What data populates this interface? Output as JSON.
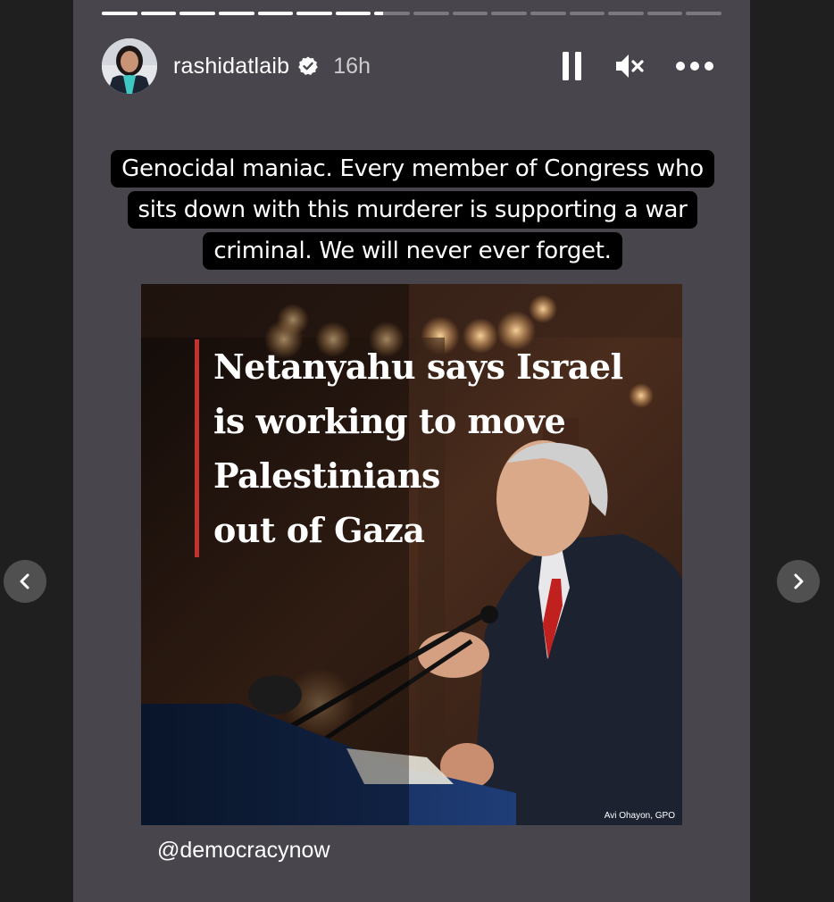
{
  "story": {
    "progress": {
      "segment_count": 16,
      "completed_segments": 7,
      "current_segment_progress": 0.25
    },
    "header": {
      "username": "rashidatlaib",
      "verified_icon": "verified-badge-icon",
      "timestamp": "16h",
      "controls": {
        "pause_icon": "pause-icon",
        "mute_icon": "muted-speaker-icon",
        "more_icon": "more-options-icon"
      }
    },
    "caption": "Genocidal maniac. Every member of Congress who sits down with this murderer is supporting a war criminal. We will never ever forget.",
    "shared_post": {
      "headline_lines": [
        "Netanyahu says Israel",
        "is working to move",
        "Palestinians",
        "out of Gaza"
      ],
      "photo_credit": "Avi Ohayon, GPO",
      "accent_color": "#c2332e"
    },
    "attribution": "@democracynow",
    "navigation": {
      "prev_icon": "chevron-left-icon",
      "next_icon": "chevron-right-icon"
    }
  },
  "colors": {
    "page_background": "#1f1f1f",
    "story_background": "#48464c",
    "caption_background": "#000000",
    "text": "#ffffff"
  }
}
